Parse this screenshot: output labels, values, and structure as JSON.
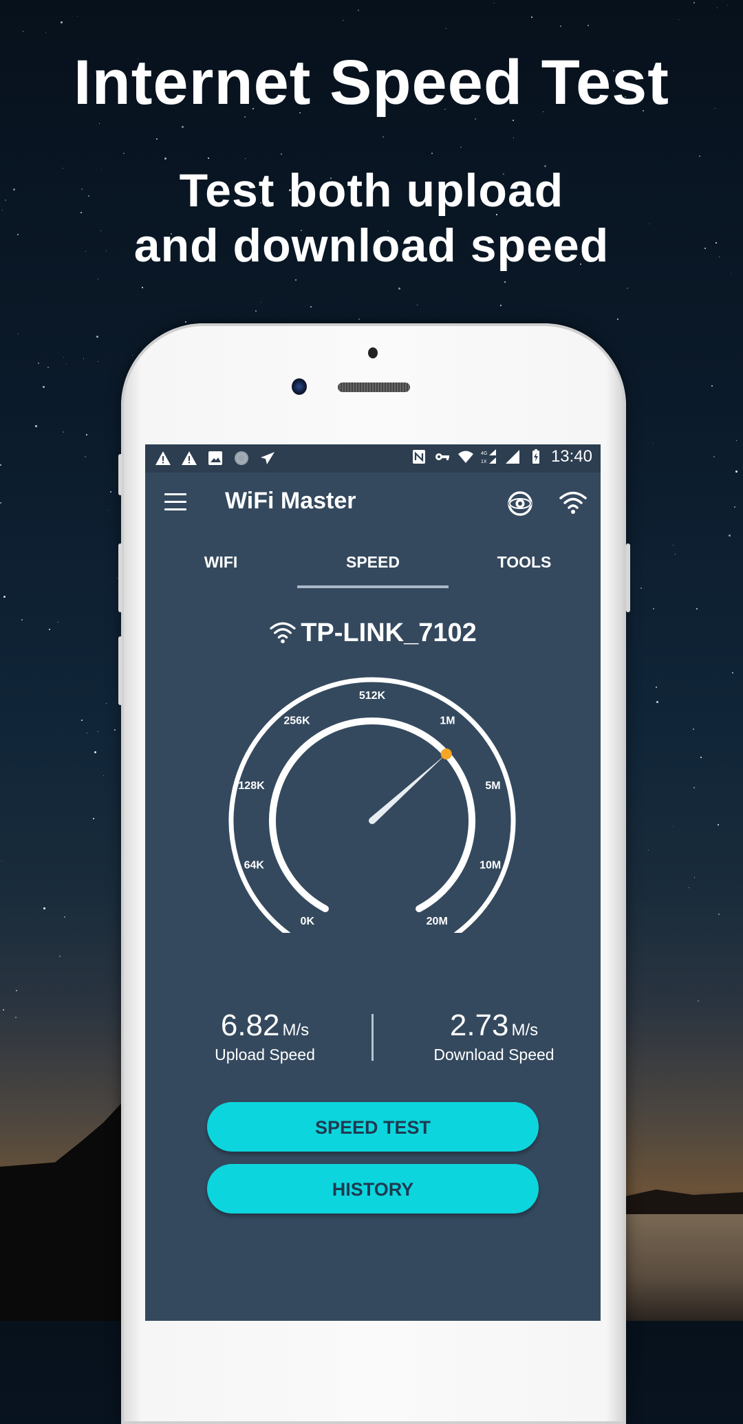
{
  "promo": {
    "headline": "Internet Speed Test",
    "subline_1": "Test both upload",
    "subline_2": "and download speed"
  },
  "status_bar": {
    "left_icons": [
      "warning-icon",
      "warning-icon",
      "image-icon",
      "circle-app-icon",
      "send-icon"
    ],
    "right_icons": [
      "nfc-icon",
      "vpn-key-icon",
      "wifi-icon",
      "signal-4g-1x-icon",
      "signal-icon",
      "battery-charging-icon"
    ],
    "time": "13:40"
  },
  "app_bar": {
    "title": "WiFi Master",
    "icons": [
      "menu-icon",
      "eye-icon",
      "wifi-icon"
    ]
  },
  "tabs": [
    {
      "label": "WIFI",
      "active": false
    },
    {
      "label": "SPEED",
      "active": true
    },
    {
      "label": "TOOLS",
      "active": false
    }
  ],
  "network": {
    "name": "TP-LINK_7102",
    "icon": "wifi-icon"
  },
  "gauge": {
    "tick_labels": [
      "0K",
      "64K",
      "128K",
      "256K",
      "512K",
      "1M",
      "5M",
      "10M",
      "20M"
    ],
    "needle_position": 0.65,
    "needle_tip_color": "#f5a623"
  },
  "stats": {
    "upload": {
      "value": "6.82",
      "unit": "M/s",
      "label": "Upload Speed"
    },
    "download": {
      "value": "2.73",
      "unit": "M/s",
      "label": "Download Speed"
    }
  },
  "buttons": {
    "speed_test": "SPEED TEST",
    "history": "HISTORY"
  },
  "colors": {
    "app_background": "#34495e",
    "status_bar": "#2c3e50",
    "accent_button": "#0dd5dd",
    "button_text": "#1e3a50"
  }
}
